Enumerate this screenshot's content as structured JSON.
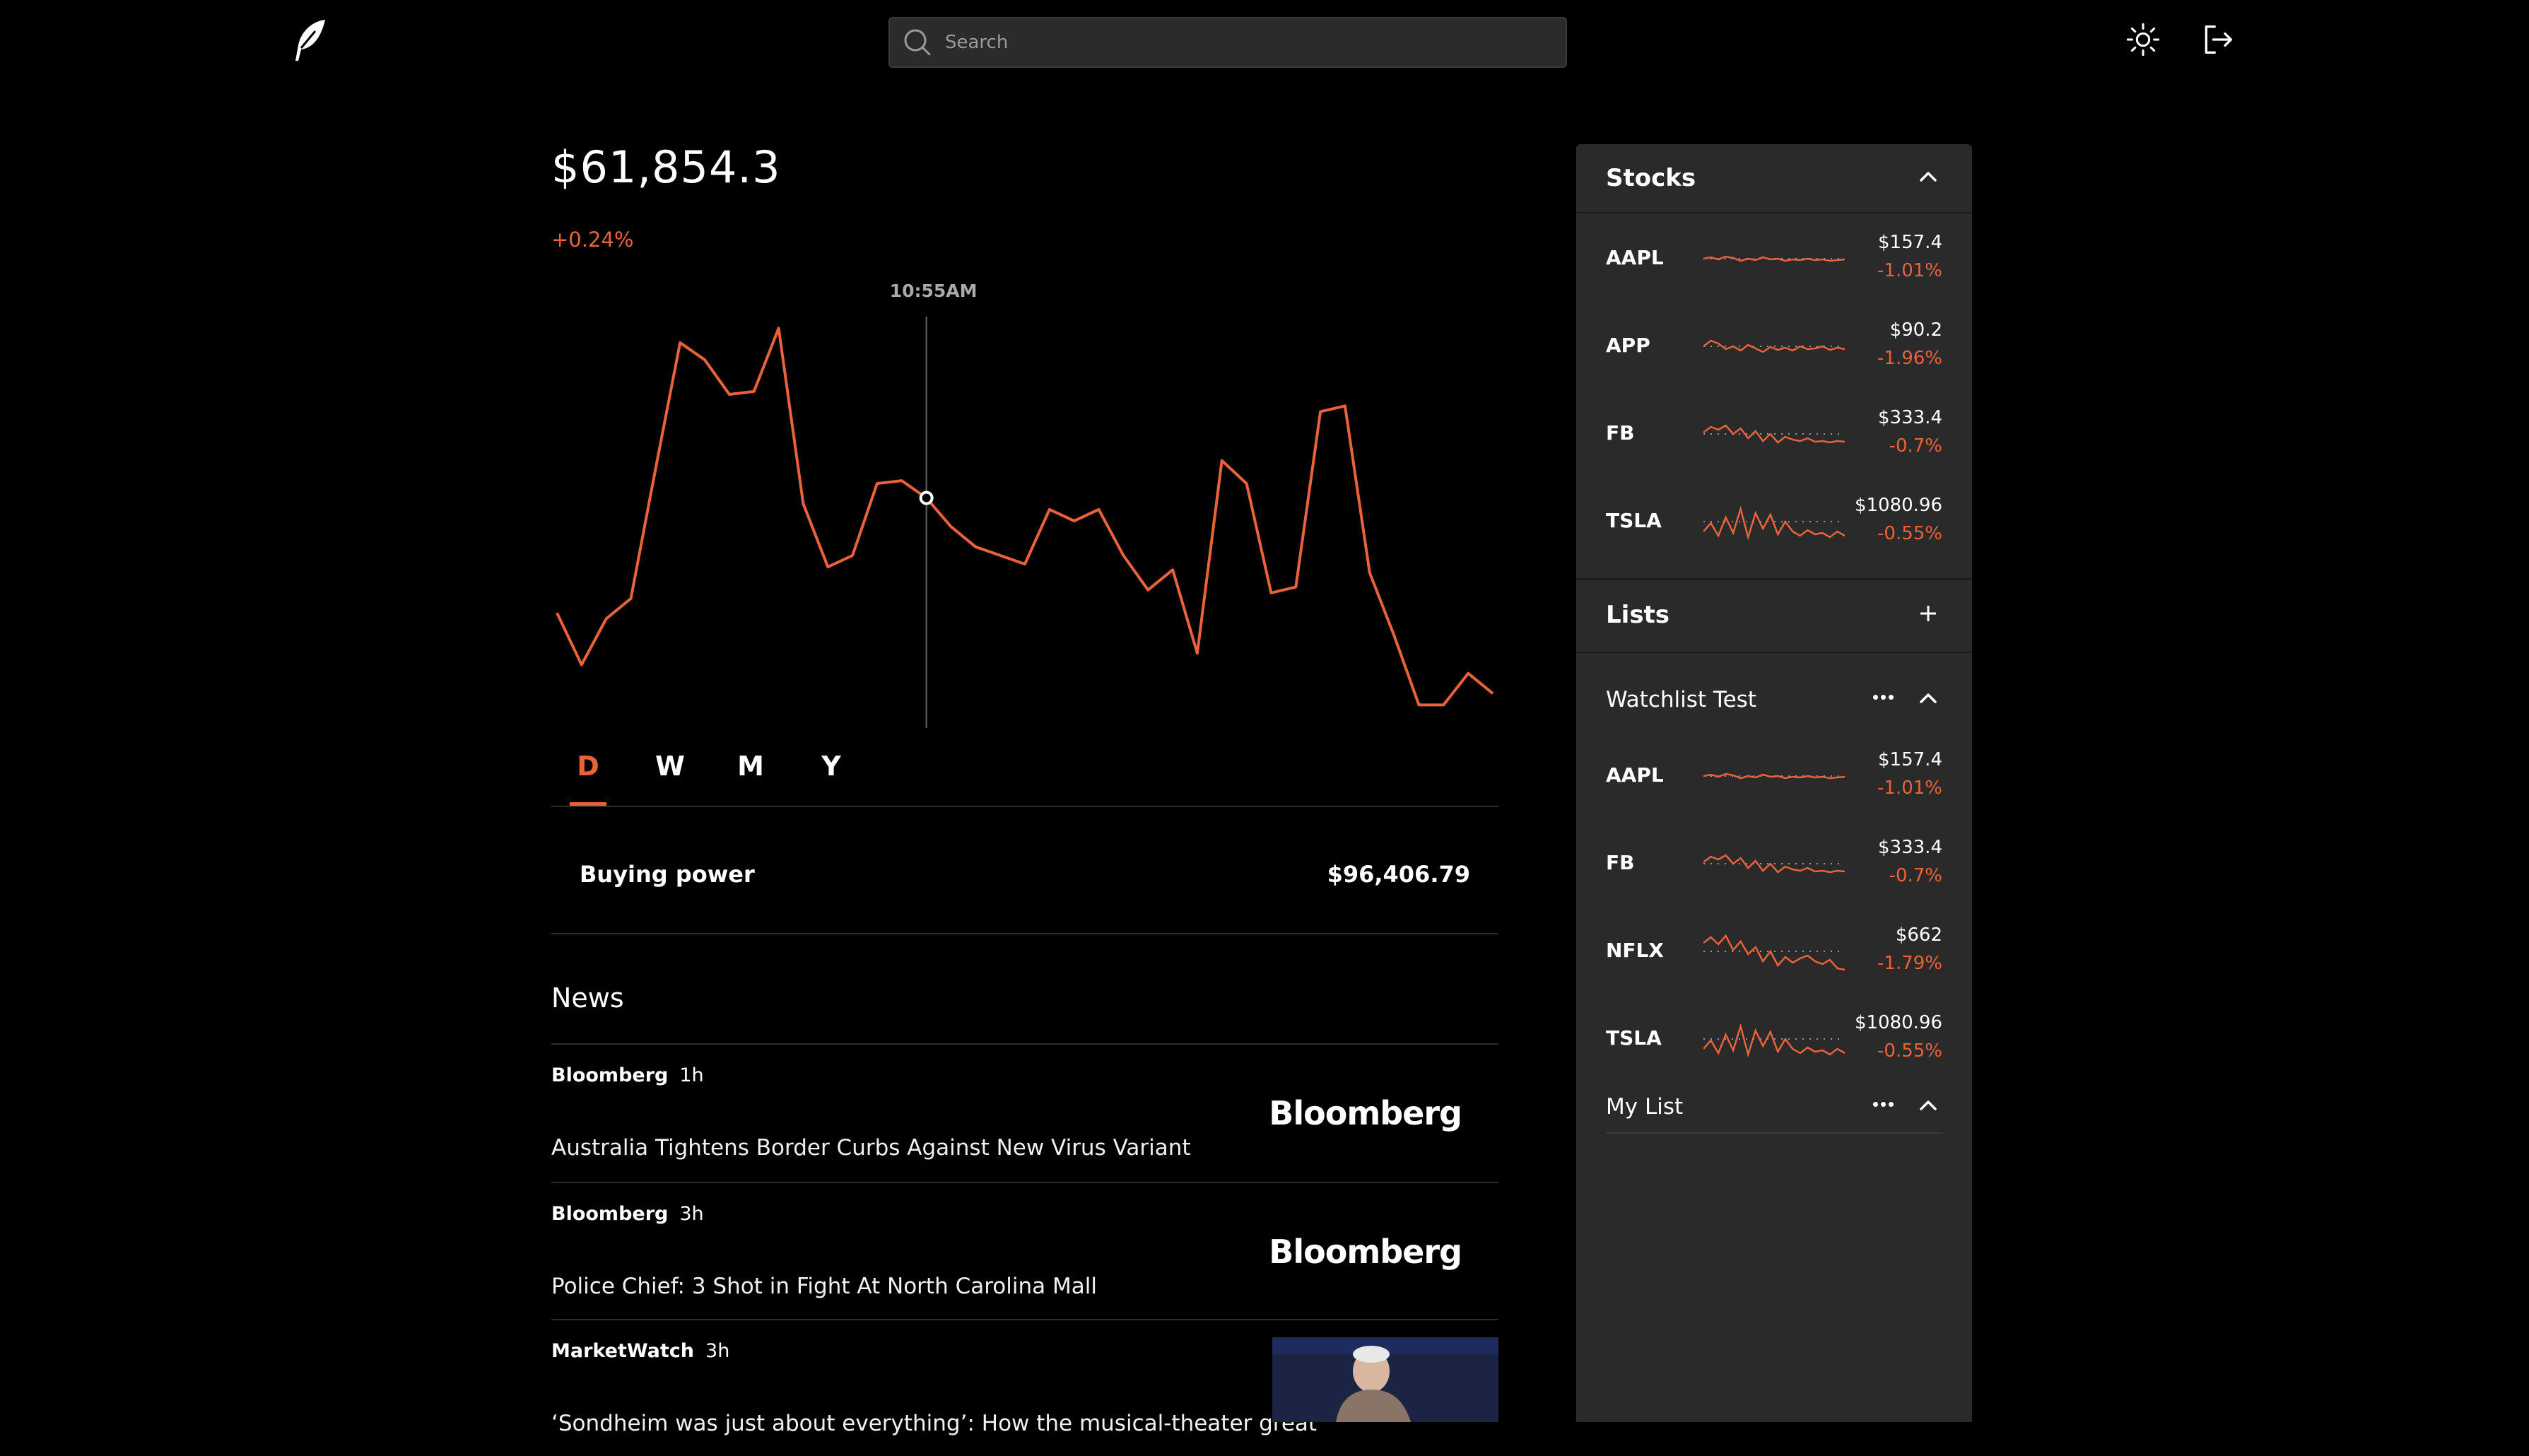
{
  "header": {
    "search_placeholder": "Search"
  },
  "icons": {
    "logo": "feather-icon",
    "search": "search-icon",
    "theme": "sun-icon",
    "logout": "logout-icon"
  },
  "colors": {
    "accent": "#e8633a",
    "background": "#000000",
    "panel": "#2a2a2a"
  },
  "portfolio": {
    "balance": "$61,854.3",
    "change": "+0.24%",
    "hover_time": "10:55AM"
  },
  "chart_data": {
    "type": "line",
    "title": "",
    "xlabel": "",
    "ylabel": "",
    "series": [
      {
        "values": [
          30,
          12,
          28,
          35,
          80,
          124,
          118,
          106,
          107,
          129,
          68,
          46,
          50,
          75,
          76,
          70,
          60,
          53,
          50,
          47,
          66,
          62,
          66,
          50,
          38,
          45,
          16,
          83,
          75,
          37,
          39,
          100,
          102,
          44,
          22,
          -2,
          -2,
          9,
          2
        ]
      }
    ],
    "hover_index": 15,
    "ylim": [
      -10,
      135
    ]
  },
  "range_tabs": [
    "D",
    "W",
    "M",
    "Y"
  ],
  "active_tab": 0,
  "account": {
    "buying_power_label": "Buying power",
    "buying_power_value": "$96,406.79"
  },
  "news": {
    "title": "News",
    "items": [
      {
        "source": "Bloomberg",
        "time": "1h",
        "headline": "Australia Tightens Border Curbs Against New Virus Variant",
        "logo_text": "Bloomberg"
      },
      {
        "source": "Bloomberg",
        "time": "3h",
        "headline": "Police Chief: 3 Shot in Fight At North Carolina Mall",
        "logo_text": "Bloomberg"
      },
      {
        "source": "MarketWatch",
        "time": "3h",
        "headline": "‘Sondheim was just about everything’: How the musical-theater great"
      }
    ]
  },
  "sidebar": {
    "stocks_title": "Stocks",
    "lists_title": "Lists",
    "stocks": [
      {
        "symbol": "AAPL",
        "price": "$157.4",
        "change": "-1.01%"
      },
      {
        "symbol": "APP",
        "price": "$90.2",
        "change": "-1.96%"
      },
      {
        "symbol": "FB",
        "price": "$333.4",
        "change": "-0.7%"
      },
      {
        "symbol": "TSLA",
        "price": "$1080.96",
        "change": "-0.55%"
      }
    ],
    "watchlist": {
      "name": "Watchlist Test",
      "items": [
        {
          "symbol": "AAPL",
          "price": "$157.4",
          "change": "-1.01%"
        },
        {
          "symbol": "FB",
          "price": "$333.4",
          "change": "-0.7%"
        },
        {
          "symbol": "NFLX",
          "price": "$662",
          "change": "-1.79%"
        },
        {
          "symbol": "TSLA",
          "price": "$1080.96",
          "change": "-0.55%"
        }
      ]
    },
    "my_list": {
      "name": "My List"
    }
  }
}
